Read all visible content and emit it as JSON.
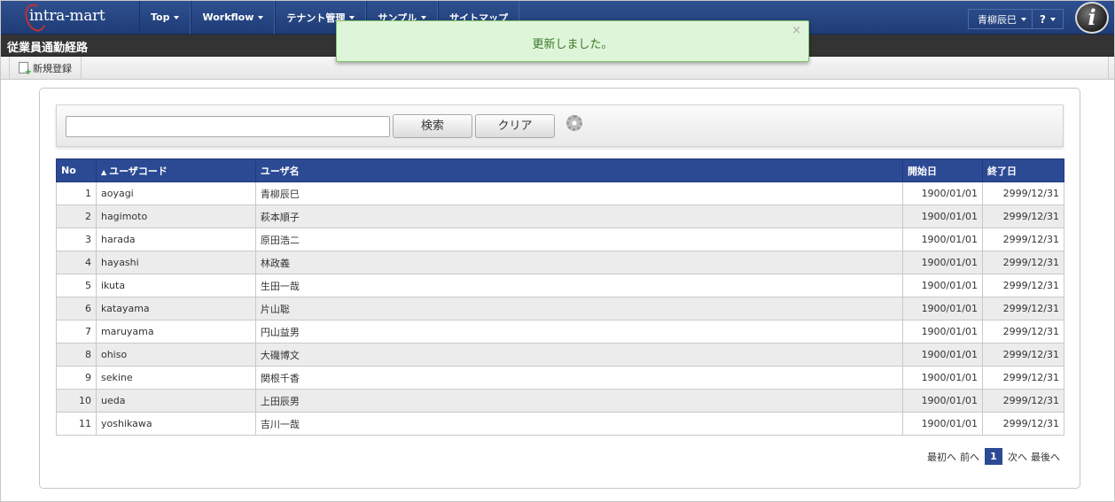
{
  "header": {
    "logo_text": "intra-mart",
    "nav": [
      {
        "label": "Top",
        "has_caret": true
      },
      {
        "label": "Workflow",
        "has_caret": true
      },
      {
        "label": "テナント管理",
        "has_caret": true
      },
      {
        "label": "サンプル",
        "has_caret": true
      },
      {
        "label": "サイトマップ",
        "has_caret": false
      }
    ],
    "user_name": "青柳辰巳",
    "help_label": "?",
    "brand_icon": "i"
  },
  "page": {
    "title": "従業員通勤経路",
    "new_button_label": "新規登録"
  },
  "toast": {
    "message": "更新しました。",
    "close": "×"
  },
  "search": {
    "input_value": "",
    "search_label": "検索",
    "clear_label": "クリア",
    "settings_icon": "gear-icon"
  },
  "table": {
    "headers": [
      "No",
      "ユーザコード",
      "ユーザ名",
      "開始日",
      "終了日"
    ],
    "sort_indicator": "▲",
    "rows": [
      {
        "no": "1",
        "code": "aoyagi",
        "name": "青柳辰巳",
        "start": "1900/01/01",
        "end": "2999/12/31"
      },
      {
        "no": "2",
        "code": "hagimoto",
        "name": "萩本順子",
        "start": "1900/01/01",
        "end": "2999/12/31"
      },
      {
        "no": "3",
        "code": "harada",
        "name": "原田浩二",
        "start": "1900/01/01",
        "end": "2999/12/31"
      },
      {
        "no": "4",
        "code": "hayashi",
        "name": "林政義",
        "start": "1900/01/01",
        "end": "2999/12/31"
      },
      {
        "no": "5",
        "code": "ikuta",
        "name": "生田一哉",
        "start": "1900/01/01",
        "end": "2999/12/31"
      },
      {
        "no": "6",
        "code": "katayama",
        "name": "片山聡",
        "start": "1900/01/01",
        "end": "2999/12/31"
      },
      {
        "no": "7",
        "code": "maruyama",
        "name": "円山益男",
        "start": "1900/01/01",
        "end": "2999/12/31"
      },
      {
        "no": "8",
        "code": "ohiso",
        "name": "大磯博文",
        "start": "1900/01/01",
        "end": "2999/12/31"
      },
      {
        "no": "9",
        "code": "sekine",
        "name": "関根千香",
        "start": "1900/01/01",
        "end": "2999/12/31"
      },
      {
        "no": "10",
        "code": "ueda",
        "name": "上田辰男",
        "start": "1900/01/01",
        "end": "2999/12/31"
      },
      {
        "no": "11",
        "code": "yoshikawa",
        "name": "吉川一哉",
        "start": "1900/01/01",
        "end": "2999/12/31"
      }
    ]
  },
  "pager": {
    "first": "最初へ",
    "prev": "前へ",
    "current": "1",
    "next": "次へ",
    "last": "最後へ"
  },
  "colors": {
    "header_blue": "#2e5090",
    "table_header": "#2c4a94",
    "toast_bg": "#dff5d9",
    "toast_text": "#3b7a2a"
  }
}
